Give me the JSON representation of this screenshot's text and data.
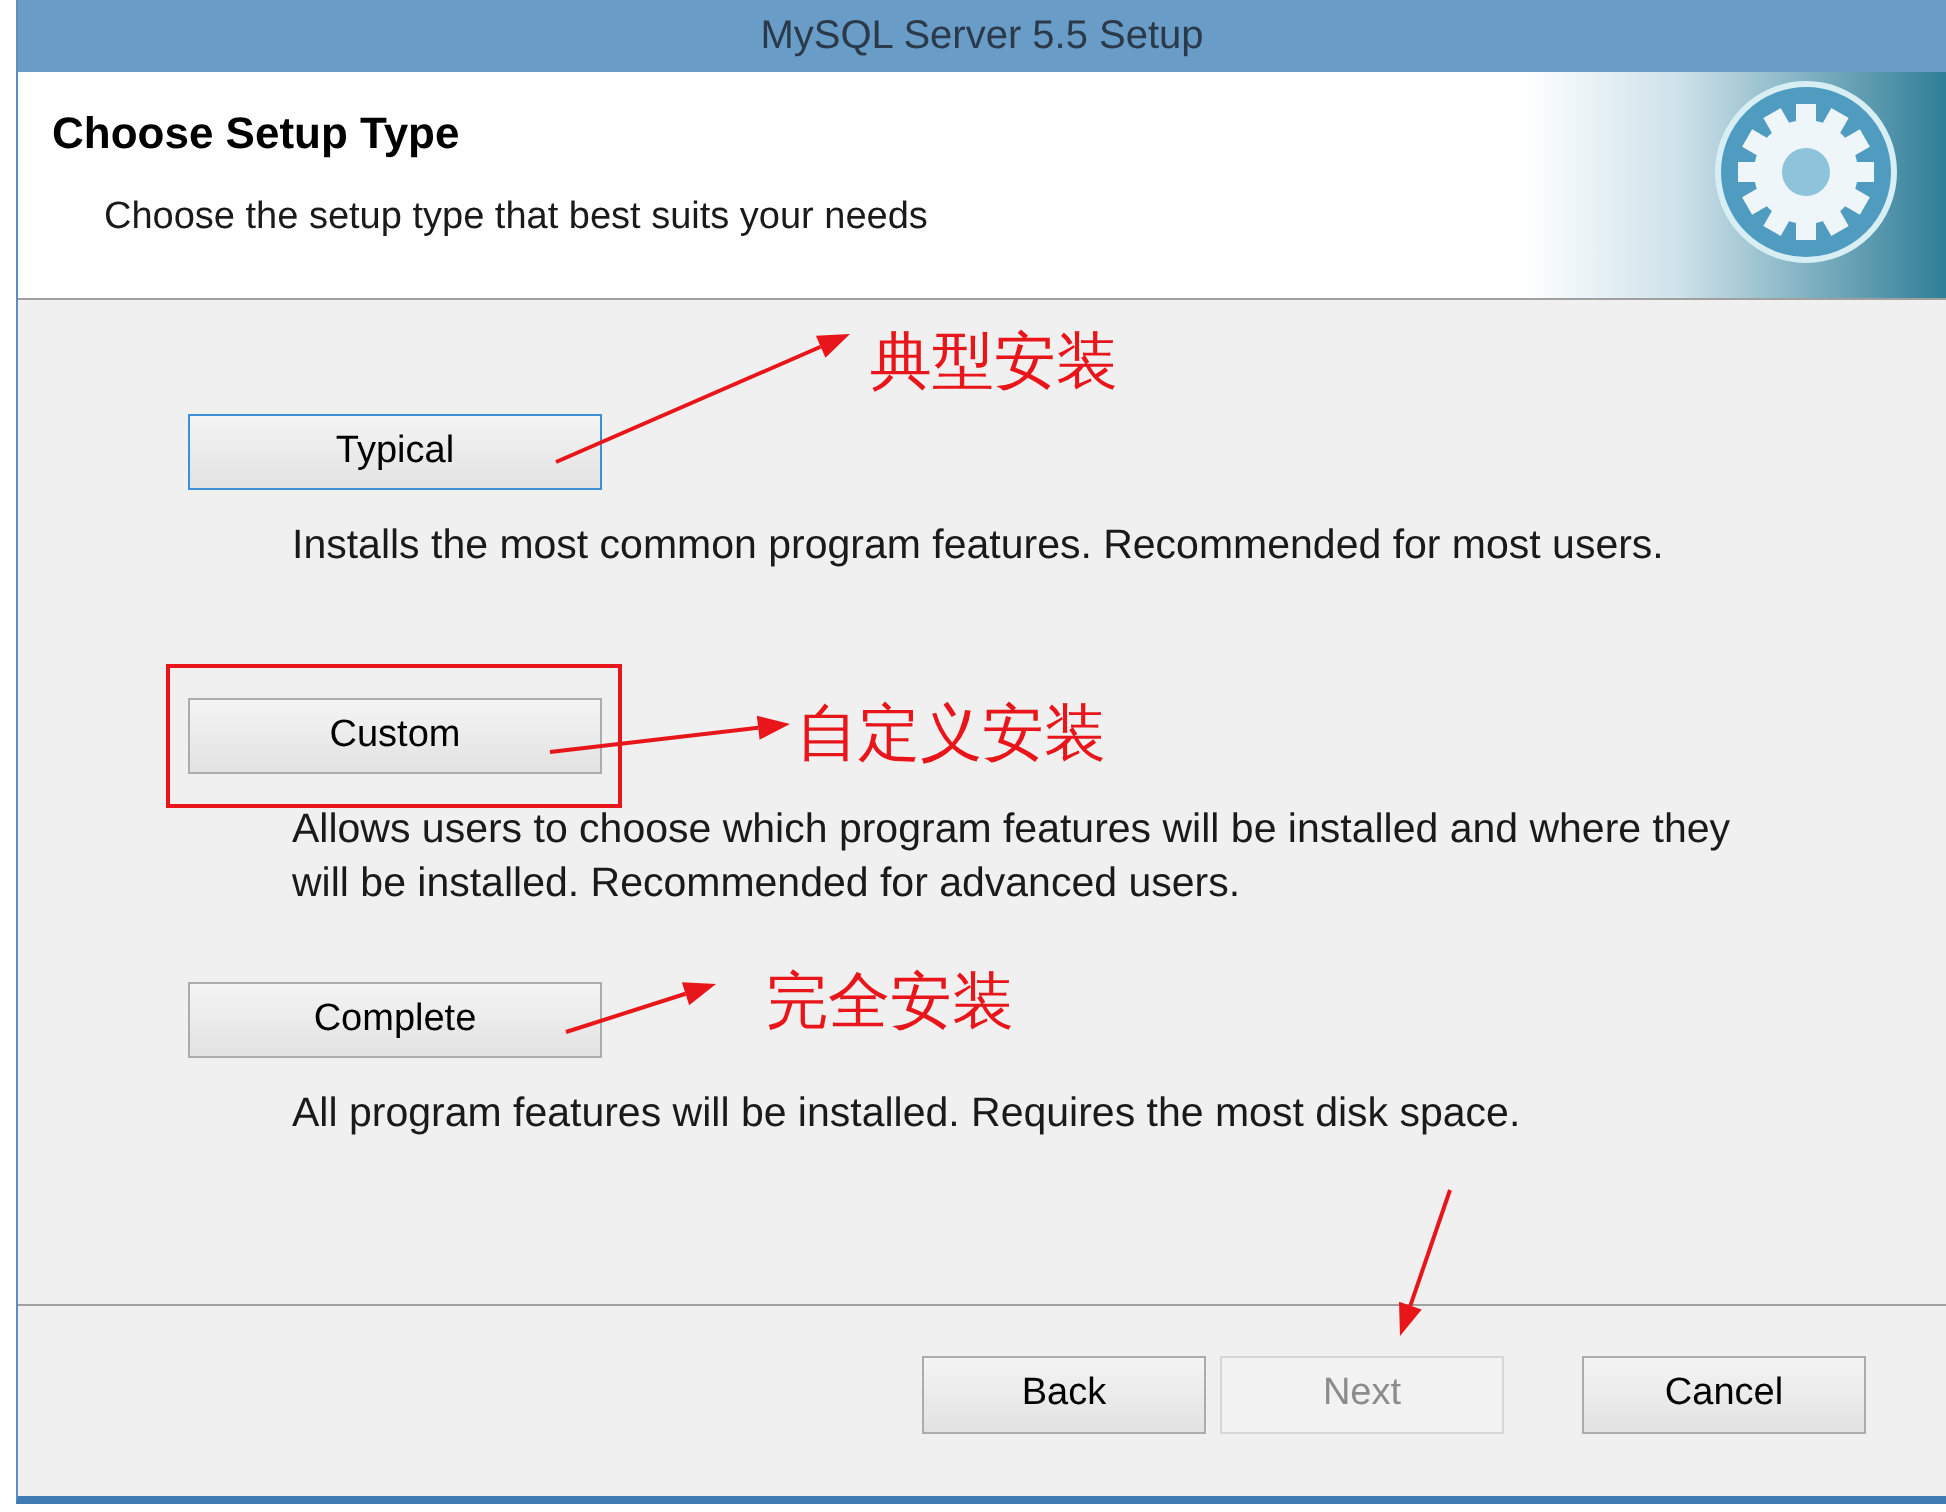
{
  "window": {
    "title": "MySQL Server 5.5 Setup"
  },
  "header": {
    "title": "Choose Setup Type",
    "subtitle": "Choose the setup type that best suits your needs"
  },
  "options": [
    {
      "label": "Typical",
      "description": "Installs the most common program features. Recommended for most users.",
      "focused": true,
      "highlighted": false
    },
    {
      "label": "Custom",
      "description": "Allows users to choose which program features will be installed and where they will be installed. Recommended for advanced users.",
      "focused": false,
      "highlighted": true
    },
    {
      "label": "Complete",
      "description": "All program features will be installed. Requires the most disk space.",
      "focused": false,
      "highlighted": false
    }
  ],
  "annotations": [
    "典型安装",
    "自定义安装",
    "完全安装"
  ],
  "buttons": [
    {
      "label": "Back",
      "disabled": false
    },
    {
      "label": "Next",
      "disabled": true
    },
    {
      "label": "Cancel",
      "disabled": false
    }
  ]
}
